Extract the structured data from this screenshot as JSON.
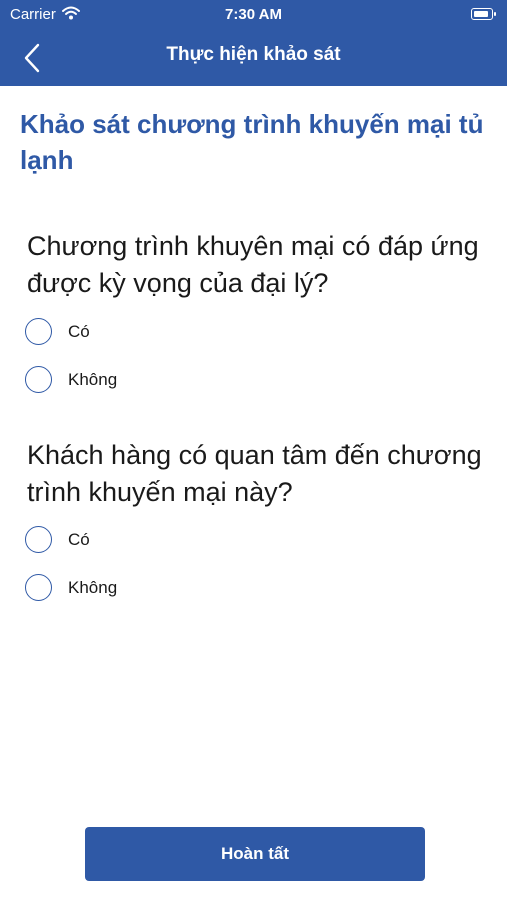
{
  "status_bar": {
    "carrier": "Carrier",
    "time": "7:30 AM"
  },
  "nav": {
    "title": "Thực hiện khảo sát",
    "back_icon": "chevron-left-icon"
  },
  "survey": {
    "title": "Khảo sát chương trình khuyến mại tủ lạnh",
    "questions": [
      {
        "text": "Chương trình khuyên mại có đáp ứng được kỳ vọng của đại lý?",
        "options": [
          "Có",
          "Không"
        ]
      },
      {
        "text": "Khách hàng có quan tâm đến chương trình khuyến mại này?",
        "options": [
          "Có",
          "Không"
        ]
      }
    ]
  },
  "submit_label": "Hoàn tất",
  "colors": {
    "primary": "#2f59a6",
    "background": "#ffffff",
    "text": "#1a1a1a"
  }
}
